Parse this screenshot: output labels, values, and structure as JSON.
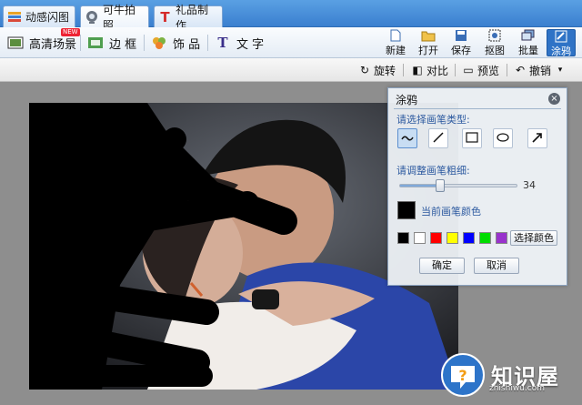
{
  "tabs": [
    {
      "label": "动感闪图",
      "icon": "flash-icon"
    },
    {
      "label": "可牛拍照",
      "icon": "camera-icon"
    },
    {
      "label": "礼品制作",
      "icon": "gift-icon"
    }
  ],
  "toolbar": {
    "items": [
      {
        "label": "高清场景",
        "badge": "NEW"
      },
      {
        "label": "边 框"
      },
      {
        "label": "饰 品"
      },
      {
        "label": "文 字"
      }
    ],
    "buttons": [
      {
        "label": "新建"
      },
      {
        "label": "打开"
      },
      {
        "label": "保存"
      },
      {
        "label": "抠图"
      },
      {
        "label": "批量"
      },
      {
        "label": "涂鸦"
      }
    ]
  },
  "editbar": {
    "rotate": "旋转",
    "compare": "对比",
    "preview": "预览",
    "undo": "撤销"
  },
  "dialog": {
    "title": "涂鸦",
    "brush_type_label": "请选择画笔类型:",
    "brush_size_label": "请调整画笔粗细:",
    "brush_size_value": "34",
    "brush_size_fraction": 0.34,
    "current_color_label": "当前画笔颜色",
    "current_color": "#000000",
    "swatches": [
      "#000000",
      "#ffffff",
      "#ff0000",
      "#ffff00",
      "#0000ff",
      "#00dd00",
      "#9933cc"
    ],
    "pick_color_label": "选择颜色",
    "ok_label": "确定",
    "cancel_label": "取消"
  },
  "watermark": {
    "brand": "知识屋",
    "url": "zhishiwu.com"
  }
}
